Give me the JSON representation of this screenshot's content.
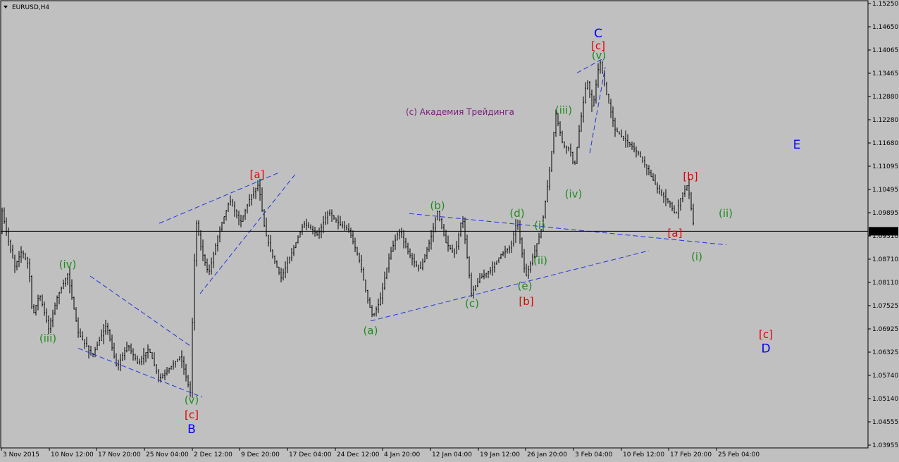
{
  "header": {
    "symbol_label": "EURUSD,H4",
    "watermark": "(c) Академия Трейдинга",
    "current_price_label": "1.09397"
  },
  "colors": {
    "background": "#c0c0c0",
    "candle": "#000000",
    "wave_green": "#1e8c1e",
    "wave_red": "#e00000",
    "wave_blue": "#0000ee",
    "channel_line": "#2233dd",
    "watermark": "#7a1a7a",
    "price_line": "#000000"
  },
  "chart_data": {
    "type": "candlestick",
    "symbol": "EURUSD",
    "timeframe": "H4",
    "ylim": [
      1.0385,
      1.153
    ],
    "y_ticks": [
      "1.15250",
      "1.14650",
      "1.14065",
      "1.13465",
      "1.12880",
      "1.12280",
      "1.11680",
      "1.11095",
      "1.10495",
      "1.09895",
      "1.09310",
      "1.08710",
      "1.08110",
      "1.07525",
      "1.06925",
      "1.06325",
      "1.05740",
      "1.05140",
      "1.04555",
      "1.03955"
    ],
    "x_ticks": [
      "3 Nov 2015",
      "10 Nov 12:00",
      "17 Nov 20:00",
      "25 Nov 04:00",
      "2 Dec 12:00",
      "9 Dec 20:00",
      "17 Dec 04:00",
      "24 Dec 12:00",
      "4 Jan 20:00",
      "12 Jan 04:00",
      "19 Jan 12:00",
      "26 Jan 20:00",
      "3 Feb 04:00",
      "10 Feb 12:00",
      "17 Feb 20:00",
      "25 Feb 04:00"
    ],
    "current_price": 1.09397,
    "price_path": [
      [
        0,
        1.101
      ],
      [
        10,
        1.092
      ],
      [
        20,
        1.085
      ],
      [
        30,
        1.089
      ],
      [
        40,
        1.085
      ],
      [
        45,
        1.072
      ],
      [
        55,
        1.078
      ],
      [
        68,
        1.069
      ],
      [
        80,
        1.077
      ],
      [
        95,
        1.083
      ],
      [
        110,
        1.068
      ],
      [
        130,
        1.062
      ],
      [
        150,
        1.07
      ],
      [
        165,
        1.059
      ],
      [
        180,
        1.065
      ],
      [
        195,
        1.06
      ],
      [
        210,
        1.064
      ],
      [
        225,
        1.056
      ],
      [
        240,
        1.059
      ],
      [
        255,
        1.062
      ],
      [
        270,
        1.052
      ],
      [
        273,
        1.08
      ],
      [
        278,
        1.096
      ],
      [
        285,
        1.089
      ],
      [
        295,
        1.083
      ],
      [
        310,
        1.094
      ],
      [
        325,
        1.102
      ],
      [
        340,
        1.096
      ],
      [
        355,
        1.103
      ],
      [
        366,
        1.106
      ],
      [
        375,
        1.094
      ],
      [
        385,
        1.088
      ],
      [
        398,
        1.082
      ],
      [
        412,
        1.088
      ],
      [
        430,
        1.096
      ],
      [
        450,
        1.093
      ],
      [
        465,
        1.099
      ],
      [
        480,
        1.096
      ],
      [
        495,
        1.094
      ],
      [
        510,
        1.086
      ],
      [
        520,
        1.077
      ],
      [
        528,
        1.072
      ],
      [
        538,
        1.076
      ],
      [
        552,
        1.088
      ],
      [
        565,
        1.094
      ],
      [
        580,
        1.088
      ],
      [
        595,
        1.084
      ],
      [
        610,
        1.092
      ],
      [
        620,
        1.099
      ],
      [
        632,
        1.091
      ],
      [
        645,
        1.088
      ],
      [
        655,
        1.098
      ],
      [
        668,
        1.078
      ],
      [
        680,
        1.082
      ],
      [
        695,
        1.084
      ],
      [
        710,
        1.088
      ],
      [
        724,
        1.09
      ],
      [
        733,
        1.097
      ],
      [
        745,
        1.082
      ],
      [
        758,
        1.089
      ],
      [
        768,
        1.095
      ],
      [
        778,
        1.108
      ],
      [
        788,
        1.124
      ],
      [
        798,
        1.116
      ],
      [
        808,
        1.115
      ],
      [
        814,
        1.11
      ],
      [
        822,
        1.121
      ],
      [
        832,
        1.133
      ],
      [
        840,
        1.125
      ],
      [
        850,
        1.138
      ],
      [
        860,
        1.129
      ],
      [
        872,
        1.12
      ],
      [
        888,
        1.117
      ],
      [
        905,
        1.114
      ],
      [
        920,
        1.109
      ],
      [
        935,
        1.104
      ],
      [
        950,
        1.101
      ],
      [
        958,
        1.098
      ],
      [
        966,
        1.103
      ],
      [
        975,
        1.106
      ],
      [
        985,
        1.0935
      ]
    ],
    "wave_labels": [
      {
        "text": "(iii)",
        "color": "green",
        "time": 67,
        "price": 1.0665
      },
      {
        "text": "(iv)",
        "color": "green",
        "time": 95,
        "price": 1.0855
      },
      {
        "text": "(v)",
        "color": "green",
        "time": 271,
        "price": 1.0508
      },
      {
        "text": "[c]",
        "color": "red",
        "time": 271,
        "price": 1.047
      },
      {
        "text": "B",
        "color": "blue",
        "time": 271,
        "price": 1.0432
      },
      {
        "text": "[a]",
        "color": "red",
        "time": 364,
        "price": 1.1085
      },
      {
        "text": "(a)",
        "color": "green",
        "time": 525,
        "price": 1.0685
      },
      {
        "text": "(b)",
        "color": "green",
        "time": 620,
        "price": 1.1005
      },
      {
        "text": "(c)",
        "color": "green",
        "time": 669,
        "price": 1.0755
      },
      {
        "text": "(d)",
        "color": "green",
        "time": 733,
        "price": 1.0985
      },
      {
        "text": "(e)",
        "color": "green",
        "time": 744,
        "price": 1.08
      },
      {
        "text": "[b]",
        "color": "red",
        "time": 746,
        "price": 1.076
      },
      {
        "text": "(i)",
        "color": "green",
        "time": 765,
        "price": 1.0955
      },
      {
        "text": "(ii)",
        "color": "green",
        "time": 766,
        "price": 1.0865
      },
      {
        "text": "(iii)",
        "color": "green",
        "time": 799,
        "price": 1.125
      },
      {
        "text": "(iv)",
        "color": "green",
        "time": 813,
        "price": 1.1035
      },
      {
        "text": "(v)",
        "color": "green",
        "time": 849,
        "price": 1.139
      },
      {
        "text": "[c]",
        "color": "red",
        "time": 848,
        "price": 1.1415
      },
      {
        "text": "C",
        "color": "blue",
        "time": 848,
        "price": 1.1445
      },
      {
        "text": "[b]",
        "color": "red",
        "time": 979,
        "price": 1.108
      },
      {
        "text": "[a]",
        "color": "red",
        "time": 957,
        "price": 1.0935
      },
      {
        "text": "(i)",
        "color": "green",
        "time": 988,
        "price": 1.0875
      },
      {
        "text": "(ii)",
        "color": "green",
        "time": 1029,
        "price": 1.0985
      },
      {
        "text": "E",
        "color": "blue",
        "time": 1130,
        "price": 1.116
      },
      {
        "text": "[c]",
        "color": "red",
        "time": 1086,
        "price": 1.0675
      },
      {
        "text": "D",
        "color": "blue",
        "time": 1086,
        "price": 1.0638
      }
    ],
    "trend_lines": [
      {
        "from": [
          127,
          1.0825
        ],
        "to": [
          270,
          1.0645
        ]
      },
      {
        "from": [
          110,
          1.064
        ],
        "to": [
          286,
          1.0515
        ]
      },
      {
        "from": [
          225,
          1.096
        ],
        "to": [
          395,
          1.109
        ]
      },
      {
        "from": [
          283,
          1.078
        ],
        "to": [
          420,
          1.109
        ]
      },
      {
        "from": [
          525,
          1.071
        ],
        "to": [
          920,
          1.089
        ]
      },
      {
        "from": [
          580,
          1.0985
        ],
        "to": [
          1030,
          1.0905
        ]
      },
      {
        "from": [
          818,
          1.1345
        ],
        "to": [
          858,
          1.1385
        ]
      },
      {
        "from": [
          836,
          1.114
        ],
        "to": [
          858,
          1.136
        ]
      }
    ]
  }
}
